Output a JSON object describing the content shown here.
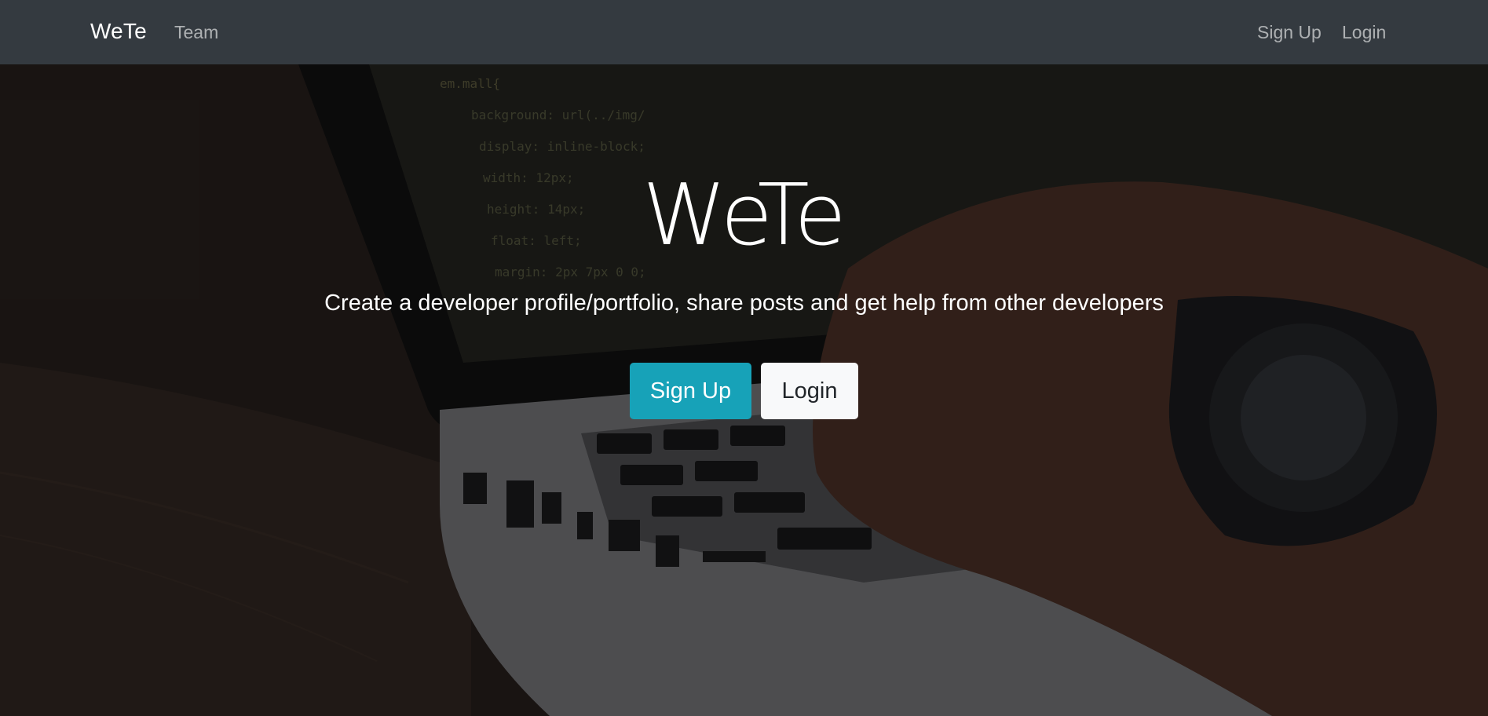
{
  "navbar": {
    "brand": "WeTe",
    "team_link": "Team",
    "signup_link": "Sign Up",
    "login_link": "Login"
  },
  "hero": {
    "title": "WeTe",
    "lead": "Create a developer profile/portfolio, share posts and get help from other developers",
    "signup_button": "Sign Up",
    "login_button": "Login"
  },
  "colors": {
    "navbar_bg": "#343a40",
    "primary_button": "#17a2b8",
    "light_button": "#f8f9fa"
  }
}
